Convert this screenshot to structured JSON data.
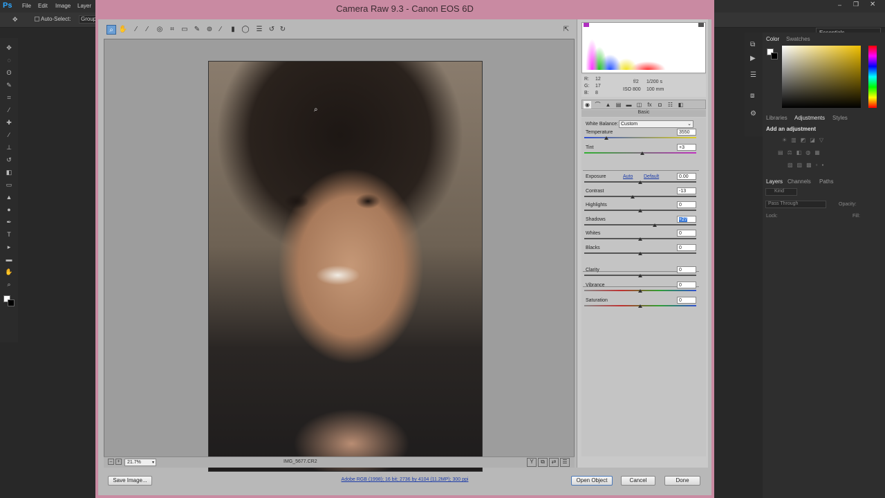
{
  "ps": {
    "logo": "Ps",
    "menu": [
      "File",
      "Edit",
      "Image",
      "Layer"
    ],
    "options": {
      "auto_select_label": "Auto-Select:",
      "group_value": "Group"
    },
    "workspace": "Essentials",
    "panels": {
      "top_tabs": [
        "Color",
        "Swatches"
      ],
      "mid_tabs": [
        "Libraries",
        "Adjustments",
        "Styles"
      ],
      "adjustments_heading": "Add an adjustment",
      "layer_tabs": [
        "Layers",
        "Channels",
        "Paths"
      ],
      "layers_kind": "Kind",
      "blend_mode": "Pass Through",
      "opacity_label": "Opacity:",
      "lock_label": "Lock:",
      "fill_label": "Fill:"
    }
  },
  "dialog": {
    "title": "Camera Raw 9.3  -  Canon EOS 6D",
    "zoom": "21.7%",
    "filename": "IMG_5677.CR2",
    "readout": {
      "r": "R:",
      "r_val": "12",
      "g": "G:",
      "g_val": "17",
      "b": "B:",
      "b_val": "8",
      "aperture": "f/2",
      "shutter": "1/200 s",
      "iso": "ISO 800",
      "focal": "100 mm"
    },
    "panel_name": "Basic",
    "white_balance_label": "White Balance:",
    "white_balance_value": "Custom",
    "sliders": [
      {
        "key": "temperature",
        "label": "Temperature",
        "value": "3550",
        "pos": 0.2
      },
      {
        "key": "tint",
        "label": "Tint",
        "value": "+3",
        "pos": 0.52
      },
      {
        "key": "exposure",
        "label": "Exposure",
        "value": "0.00",
        "pos": 0.5
      },
      {
        "key": "contrast",
        "label": "Contrast",
        "value": "-13",
        "pos": 0.43
      },
      {
        "key": "highlights",
        "label": "Highlights",
        "value": "0",
        "pos": 0.5
      },
      {
        "key": "shadows",
        "label": "Shadows",
        "value": "+27",
        "pos": 0.63
      },
      {
        "key": "whites",
        "label": "Whites",
        "value": "0",
        "pos": 0.5
      },
      {
        "key": "blacks",
        "label": "Blacks",
        "value": "0",
        "pos": 0.5
      },
      {
        "key": "clarity",
        "label": "Clarity",
        "value": "0",
        "pos": 0.5
      },
      {
        "key": "vibrance",
        "label": "Vibrance",
        "value": "0",
        "pos": 0.5
      },
      {
        "key": "saturation",
        "label": "Saturation",
        "value": "0",
        "pos": 0.5
      }
    ],
    "auto_link": "Auto",
    "default_link": "Default",
    "save_button": "Save Image...",
    "workflow_link": "Adobe RGB (1998); 16 bit; 2736 by 4104 (11.2MP); 300 ppi",
    "open_button": "Open Object",
    "cancel_button": "Cancel",
    "done_button": "Done"
  },
  "colors": {
    "dialog_frame": "#c98aa2",
    "accent": "#6c9fd4"
  }
}
